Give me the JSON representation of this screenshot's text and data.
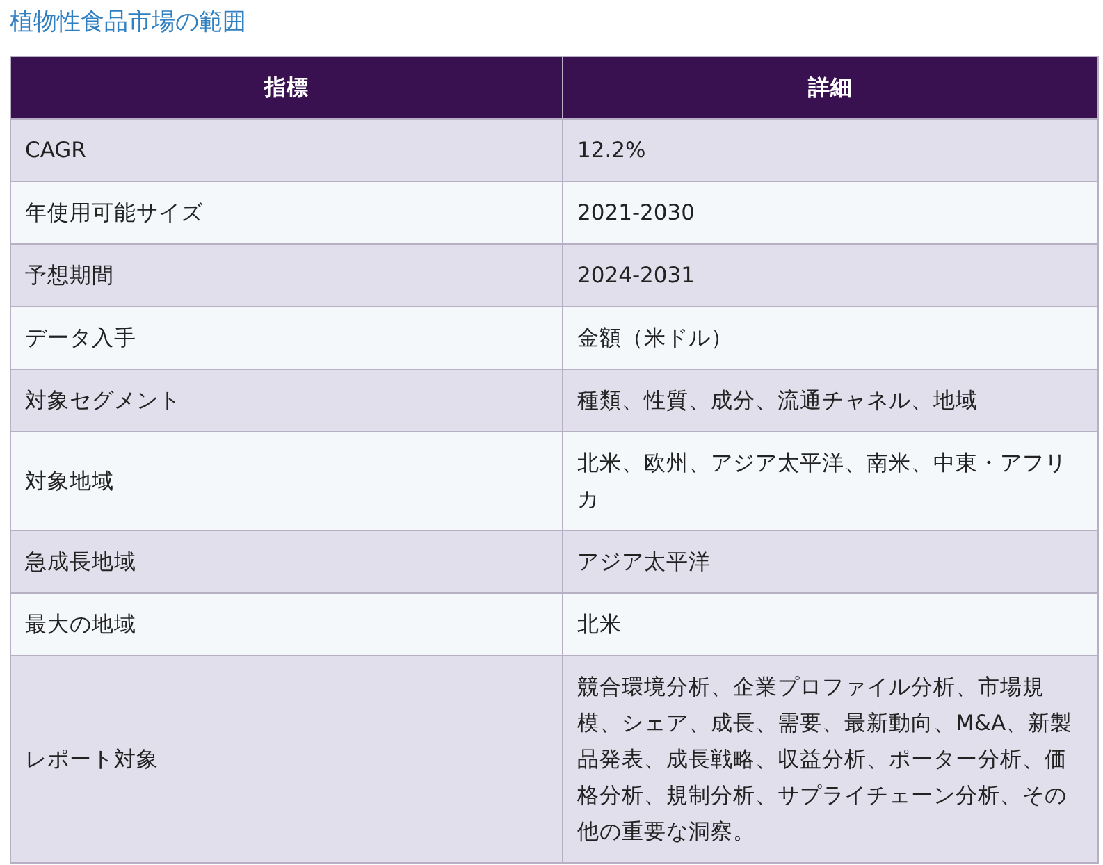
{
  "title": "植物性食品市場の範囲",
  "table": {
    "columns": [
      "指標",
      "詳細"
    ],
    "rows": [
      {
        "metric": "CAGR",
        "detail": "12.2%"
      },
      {
        "metric": "年使用可能サイズ",
        "detail": "2021-2030"
      },
      {
        "metric": "予想期間",
        "detail": "2024-2031"
      },
      {
        "metric": "データ入手",
        "detail": "金額（米ドル）"
      },
      {
        "metric": "対象セグメント",
        "detail": "種類、性質、成分、流通チャネル、地域"
      },
      {
        "metric": "対象地域",
        "detail": "北米、欧州、アジア太平洋、南米、中東・アフリカ"
      },
      {
        "metric": "急成長地域",
        "detail": "アジア太平洋"
      },
      {
        "metric": "最大の地域",
        "detail": "北米"
      },
      {
        "metric": "レポート対象",
        "detail": "競合環境分析、企業プロファイル分析、市場規模、シェア、成長、需要、最新動向、M&A、新製品発表、成長戦略、収益分析、ポーター分析、価格分析、規制分析、サプライチェーン分析、その他の重要な洞察。"
      }
    ]
  }
}
